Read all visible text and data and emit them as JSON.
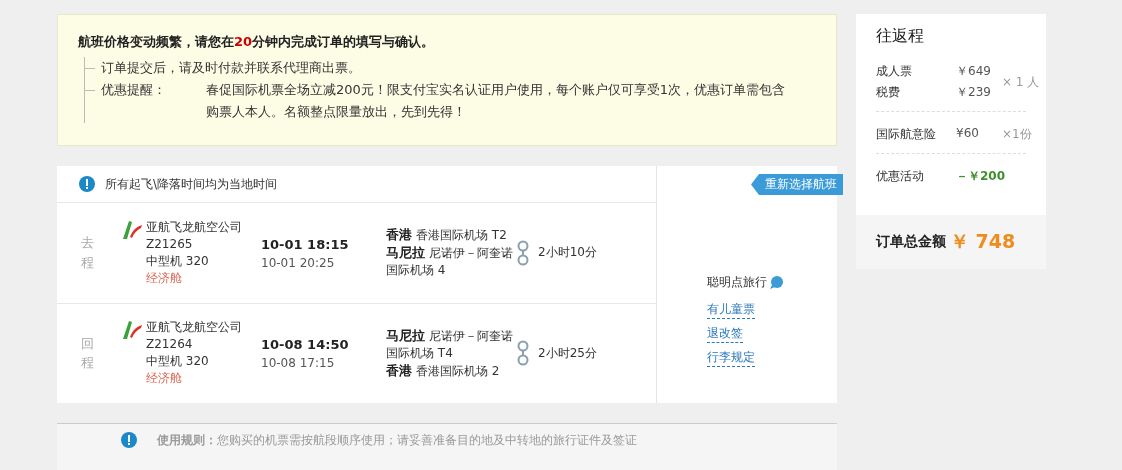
{
  "notice": {
    "headline_before": "航班价格变动频繁，请您在",
    "headline_highlight": "20",
    "headline_after": "分钟内完成订单的填写与确认。",
    "items": [
      {
        "text": "订单提交后，请及时付款并联系代理商出票。"
      },
      {
        "label": "优惠提醒：",
        "text": "春促国际机票全场立减200元！限支付宝实名认证用户使用，每个账户仅可享受1次，优惠订单需包含购票人本人。名额整点限量放出，先到先得！"
      }
    ]
  },
  "flight_card": {
    "timezone_note": "所有起飞\\降落时间均为当地时间",
    "reselect_button": "重新选择航班",
    "segments": [
      {
        "direction": "去程",
        "airline": "亚航飞龙航空公司",
        "flight_no": "Z21265",
        "aircraft": "中型机 320",
        "cabin": "经济舱",
        "depart_time": "10-01 18:15",
        "arrive_time": "10-01 20:25",
        "stops": [
          {
            "city": "香港",
            "airport": "香港国际机场 T2"
          },
          {
            "city": "马尼拉",
            "airport": "尼诺伊－阿奎诺国际机场 4"
          }
        ],
        "duration": "2小时10分"
      },
      {
        "direction": "回程",
        "airline": "亚航飞龙航空公司",
        "flight_no": "Z21264",
        "aircraft": "中型机 320",
        "cabin": "经济舱",
        "depart_time": "10-08 14:50",
        "arrive_time": "10-08 17:15",
        "stops": [
          {
            "city": "马尼拉",
            "airport": "尼诺伊－阿奎诺国际机场 T4"
          },
          {
            "city": "香港",
            "airport": "香港国际机场 2"
          }
        ],
        "duration": "2小时25分"
      }
    ],
    "sidebar": {
      "title": "聪明点旅行",
      "links": [
        "有儿童票",
        "退改签",
        "行李规定"
      ]
    }
  },
  "rules": {
    "label": "使用规则：",
    "text": "您购买的机票需按航段顺序使用；请妥善准备目的地及中转地的旅行证件及签证"
  },
  "price": {
    "title": "往返程",
    "groups": [
      {
        "kind": "multi",
        "rows": [
          {
            "label": "成人票",
            "amount": "￥649"
          },
          {
            "label": "税费",
            "amount": "￥239"
          }
        ],
        "multiplier": "× 1 人"
      },
      {
        "kind": "single",
        "rows": [
          {
            "label": "国际航意险",
            "amount": "¥60"
          }
        ],
        "multiplier": "×1份"
      },
      {
        "kind": "discount",
        "rows": [
          {
            "label": "优惠活动",
            "amount": "－￥200"
          }
        ]
      }
    ],
    "total_label": "订单总金额",
    "total": "￥ 748"
  }
}
